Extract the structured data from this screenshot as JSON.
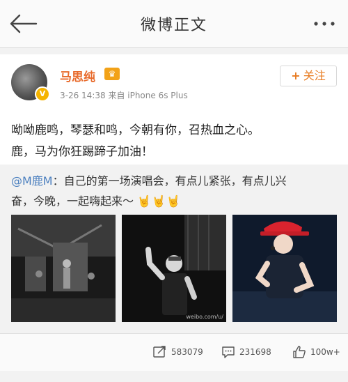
{
  "header": {
    "title": "微博正文"
  },
  "post": {
    "author": "马思纯",
    "meta": "3-26 14:38  来自 iPhone 6s Plus",
    "follow_label": "关注",
    "text_line1": "呦呦鹿鸣，琴瑟和鸣，今朝有你，召热血之心。",
    "text_line2": "鹿，马为你狂踢蹄子加油！"
  },
  "repost": {
    "mention": "@M鹿M",
    "text_line1": "：自己的第一场演唱会，有点儿紧张，有点儿兴",
    "text_line2": "奋，今晚，一起嗨起来～",
    "watermark": "weibo.com/u/"
  },
  "actions": {
    "repost_count": "583079",
    "comment_count": "231698",
    "like_count": "100w+"
  },
  "colors": {
    "username": "#e86b2c",
    "link": "#4a7fbf",
    "follow": "#e87c22",
    "vip": "#f2a218"
  }
}
